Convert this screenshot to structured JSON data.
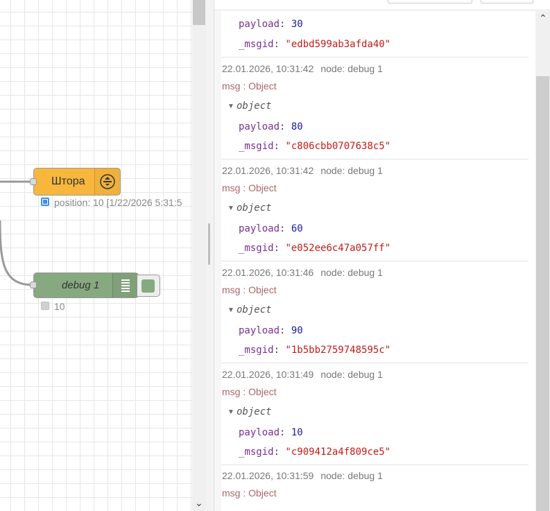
{
  "flow": {
    "nodes": {
      "shtora": {
        "label": "Штора",
        "color": "#f7b73d",
        "icon": "blinds-icon",
        "status_text": "position: 10 [1/22/2026 5:31:5"
      },
      "debug": {
        "label": "debug 1",
        "color": "#87a980",
        "icon": "list-icon",
        "status_text": "10"
      }
    }
  },
  "debug_panel": {
    "first_partial": {
      "payload_key": "payload",
      "payload_value": "30",
      "msgid_key": "_msgid",
      "msgid_value": "\"edbd599ab3afda40\""
    },
    "messages": [
      {
        "timestamp": "22.01.2026, 10:31:42",
        "node": "node: debug 1",
        "topic": "msg : Object",
        "object_label": "object",
        "payload_key": "payload",
        "payload_value": "80",
        "msgid_key": "_msgid",
        "msgid_value": "\"c806cbb0707638c5\""
      },
      {
        "timestamp": "22.01.2026, 10:31:42",
        "node": "node: debug 1",
        "topic": "msg : Object",
        "object_label": "object",
        "payload_key": "payload",
        "payload_value": "60",
        "msgid_key": "_msgid",
        "msgid_value": "\"e052ee6c47a057ff\""
      },
      {
        "timestamp": "22.01.2026, 10:31:46",
        "node": "node: debug 1",
        "topic": "msg : Object",
        "object_label": "object",
        "payload_key": "payload",
        "payload_value": "90",
        "msgid_key": "_msgid",
        "msgid_value": "\"1b5bb2759748595c\""
      },
      {
        "timestamp": "22.01.2026, 10:31:49",
        "node": "node: debug 1",
        "topic": "msg : Object",
        "object_label": "object",
        "payload_key": "payload",
        "payload_value": "10",
        "msgid_key": "_msgid",
        "msgid_value": "\"c909412a4f809ce5\""
      }
    ],
    "last_partial": {
      "timestamp": "22.01.2026, 10:31:59",
      "node": "node: debug 1",
      "topic": "msg : Object"
    }
  }
}
